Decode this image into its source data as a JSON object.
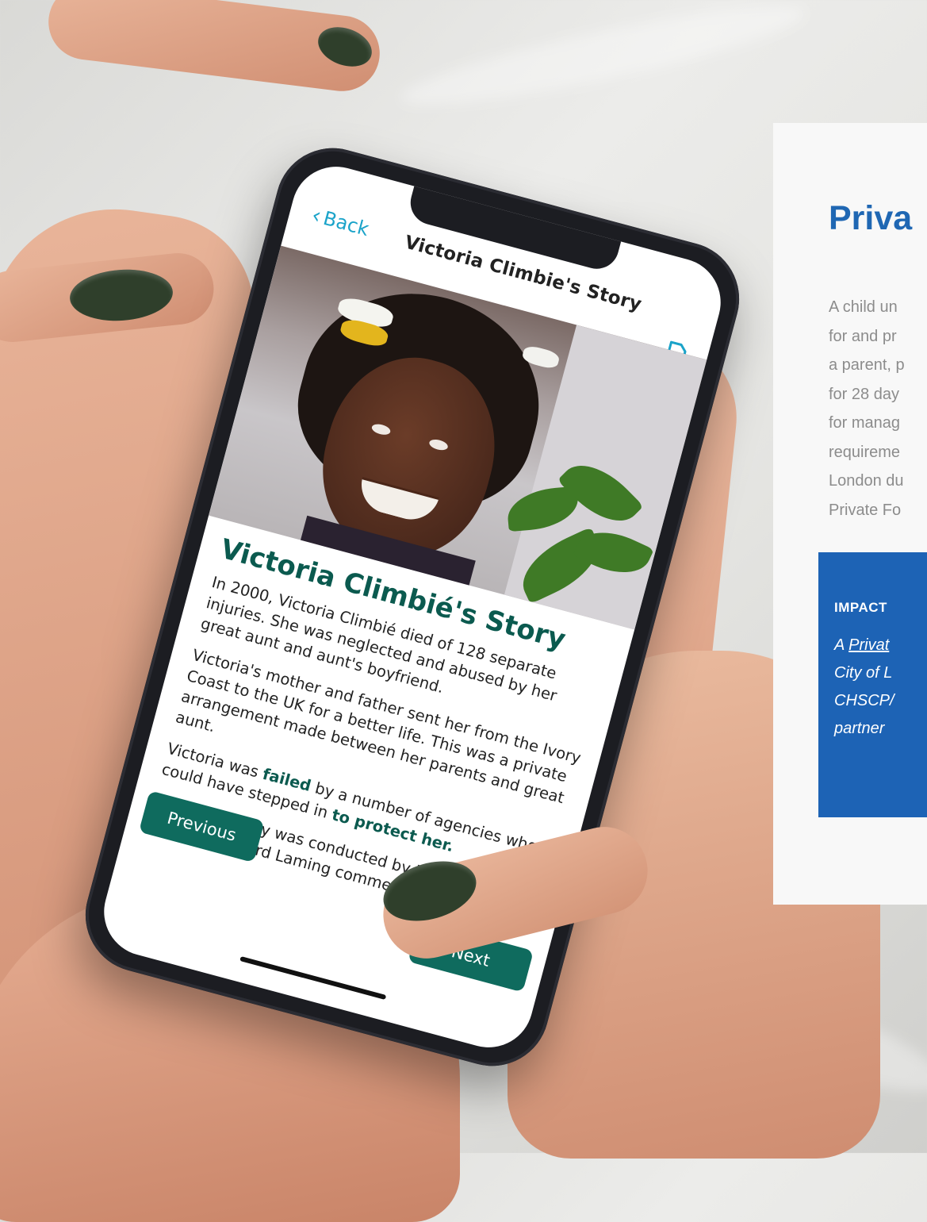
{
  "phone_app": {
    "back_label": "Back",
    "header_title": "Victoria Climbie's Story",
    "story_heading": "Victoria Climbié's Story",
    "paragraphs": [
      "In 2000, Victoria Climbié died of 128 separate injuries. She was neglected and abused by her great aunt and aunt's boyfriend.",
      "Victoria's mother and father sent her from the Ivory Coast to the UK for a better life. This was a private arrangement made between her parents and great aunt."
    ],
    "p3_start": "Victoria was ",
    "p3_bold1": "failed",
    "p3_mid": " by a number of agencies who could have stepped in ",
    "p3_bold2": "to protect her.",
    "p4": "A public inquiry was conducted by Lord Laming. In his findings Lord Laming commented,",
    "previous_label": "Previous",
    "next_label": "Next",
    "colors": {
      "accent": "#0f6b5e",
      "back_link": "#1aa3c9"
    },
    "icons": [
      "chevron-left-icon",
      "document-icon"
    ]
  },
  "info_panel": {
    "title": "Priva",
    "text_lines": [
      "A child un",
      "for and pr",
      "a parent, p",
      "for 28 day",
      "for manag",
      "requireme",
      "London du",
      "Private Fo"
    ],
    "impact_label": "IMPACT",
    "impact_lines": [
      {
        "prefix": "A ",
        "link": "Privat"
      },
      {
        "prefix": "City of L",
        "link": ""
      },
      {
        "prefix": "CHSCP/",
        "link": ""
      },
      {
        "prefix": "partner",
        "link": ""
      }
    ],
    "colors": {
      "title": "#1f67b3",
      "impact_bg": "#1d63b5",
      "text": "#8c8c8c"
    }
  }
}
